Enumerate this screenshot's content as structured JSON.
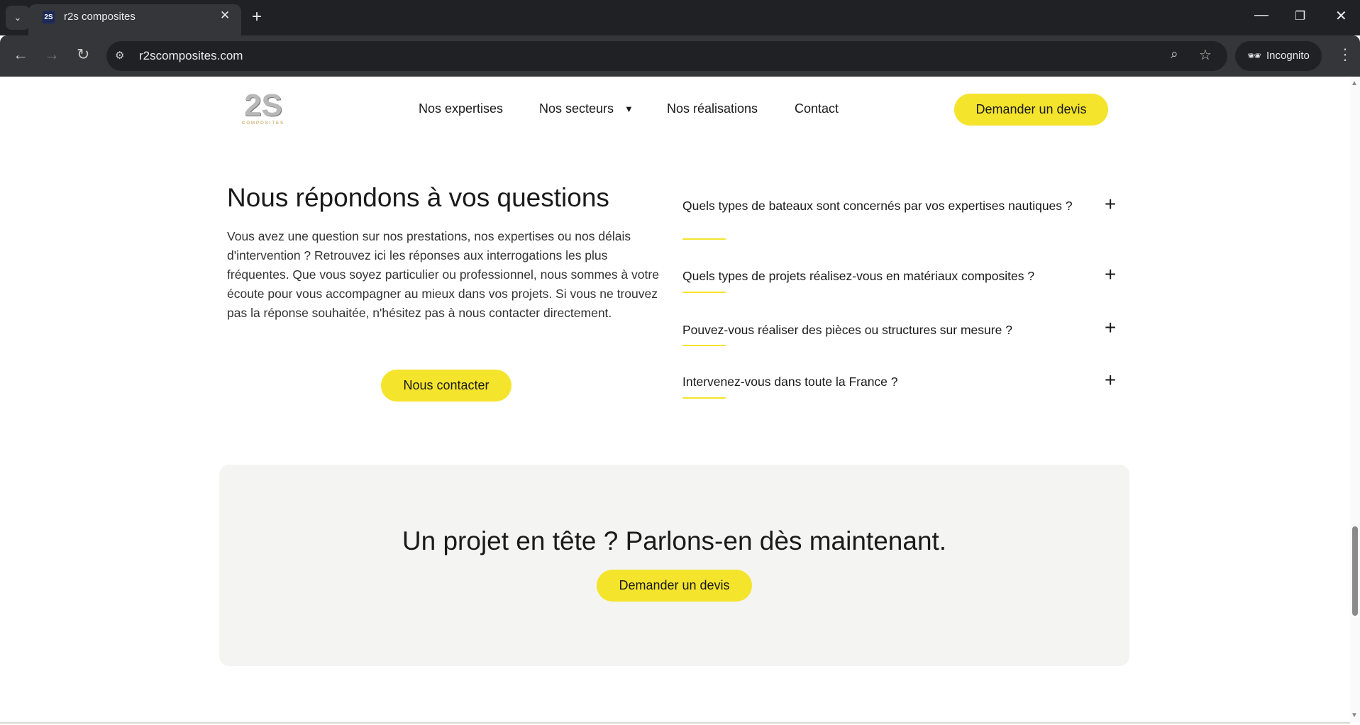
{
  "browser": {
    "tab_title": "r2s composites",
    "url": "r2scomposites.com",
    "incognito_label": "Incognito"
  },
  "header": {
    "logo_text": "2S COMPOSITES",
    "nav": [
      "Nos expertises",
      "Nos secteurs",
      "Nos réalisations",
      "Contact"
    ],
    "cta": "Demander un devis"
  },
  "faq": {
    "title": "Nous répondons à vos questions",
    "intro": "Vous avez une question sur nos prestations, nos expertises ou nos délais d'intervention ? Retrouvez ici les réponses aux interrogations les plus fréquentes. Que vous soyez particulier ou professionnel, nous sommes à votre écoute pour vous accompagner au mieux dans vos projets. Si vous ne trouvez pas la réponse souhaitée, n'hésitez pas à nous contacter directement.",
    "contact_button": "Nous contacter",
    "questions": [
      "Quels types de bateaux sont concernés par vos expertises nautiques ?",
      "Quels types de projets réalisez-vous en matériaux composites ?",
      "Pouvez-vous réaliser des pièces ou structures sur mesure ?",
      "Intervenez-vous dans toute la France ?"
    ]
  },
  "cta": {
    "title": "Un projet en tête ? Parlons-en dès maintenant.",
    "button": "Demander un devis"
  },
  "colors": {
    "accent": "#f4e42c",
    "panel": "#f4f4f2"
  }
}
